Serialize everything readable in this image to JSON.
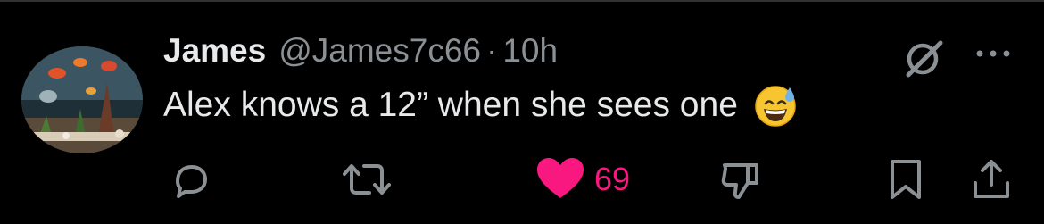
{
  "tweet": {
    "author_name": "James",
    "author_handle": "@James7c66",
    "separator": "·",
    "time_ago": "10h",
    "text": "Alex knows a 12” when she sees one",
    "emoji": "grinning-face-with-sweat"
  },
  "actions": {
    "reply_icon": "reply-icon",
    "retweet_icon": "retweet-icon",
    "like_icon": "heart-icon",
    "like_count": "69",
    "liked": true,
    "dislike_icon": "thumbs-down-icon",
    "bookmark_icon": "bookmark-icon",
    "share_icon": "share-icon"
  },
  "colors": {
    "background": "#000000",
    "primary_text": "#e7e9ea",
    "secondary_text": "#8b9095",
    "like_active": "#f91880",
    "icon": "#8b9095",
    "divider": "#2f3336"
  }
}
